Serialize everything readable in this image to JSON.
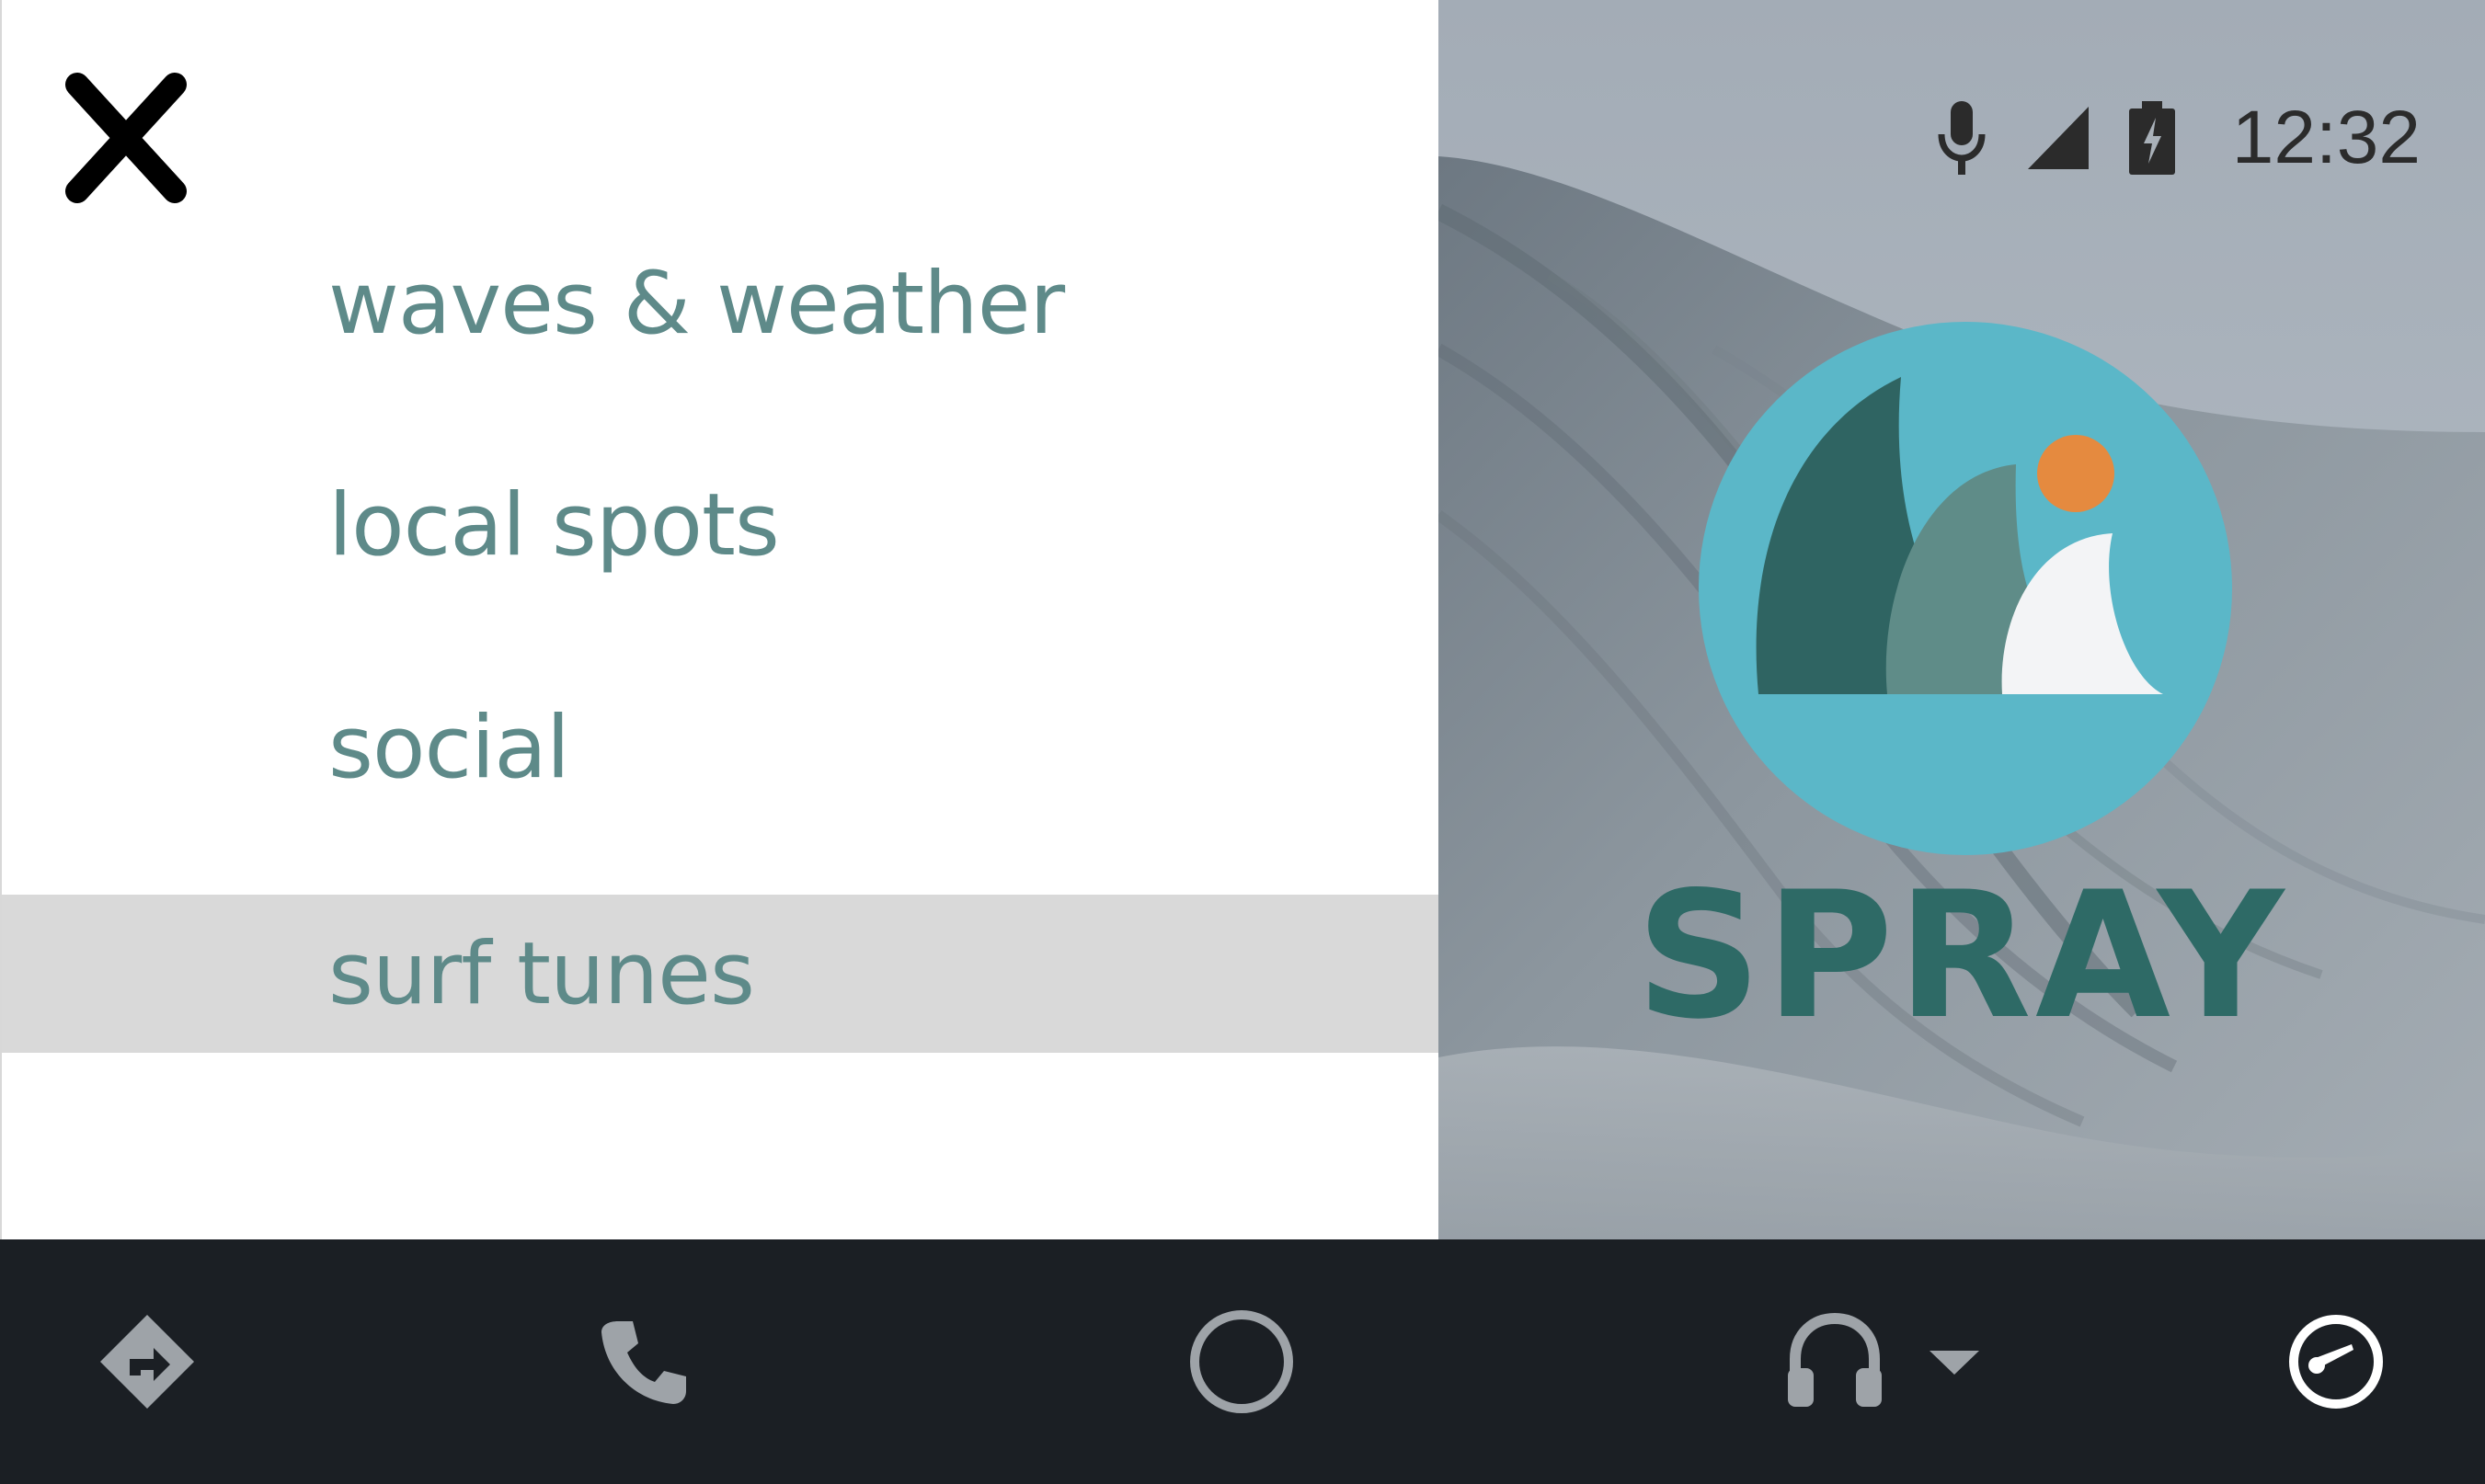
{
  "drawer": {
    "close_icon": "close-icon",
    "close_label": "X",
    "items": [
      {
        "label": "waves & weather",
        "selected": false
      },
      {
        "label": "local spots",
        "selected": false
      },
      {
        "label": "social",
        "selected": false
      },
      {
        "label": "surf tunes",
        "selected": true
      }
    ],
    "text_color": "#5e8a89",
    "selected_bg": "#d9d9d9"
  },
  "status_bar": {
    "icons": [
      "microphone-icon",
      "cell-signal-icon",
      "battery-charging-icon"
    ],
    "time": "12:32"
  },
  "app": {
    "name": "SPRAY",
    "brand_color": "#2e6a66",
    "logo_colors": {
      "circle": "#5bb7c8",
      "wave_dark": "#2f6462",
      "wave_mid": "#5f8c88",
      "wave_light": "#f3f4f6",
      "sun": "#e58a3f"
    }
  },
  "navbar": {
    "buttons": [
      {
        "icon": "navigation-icon",
        "active": false
      },
      {
        "icon": "phone-icon",
        "active": false
      },
      {
        "icon": "home-circle-icon",
        "active": false
      },
      {
        "icon": "headphones-icon",
        "active": false
      },
      {
        "icon": "overview-dashboard-icon",
        "active": true
      }
    ]
  }
}
